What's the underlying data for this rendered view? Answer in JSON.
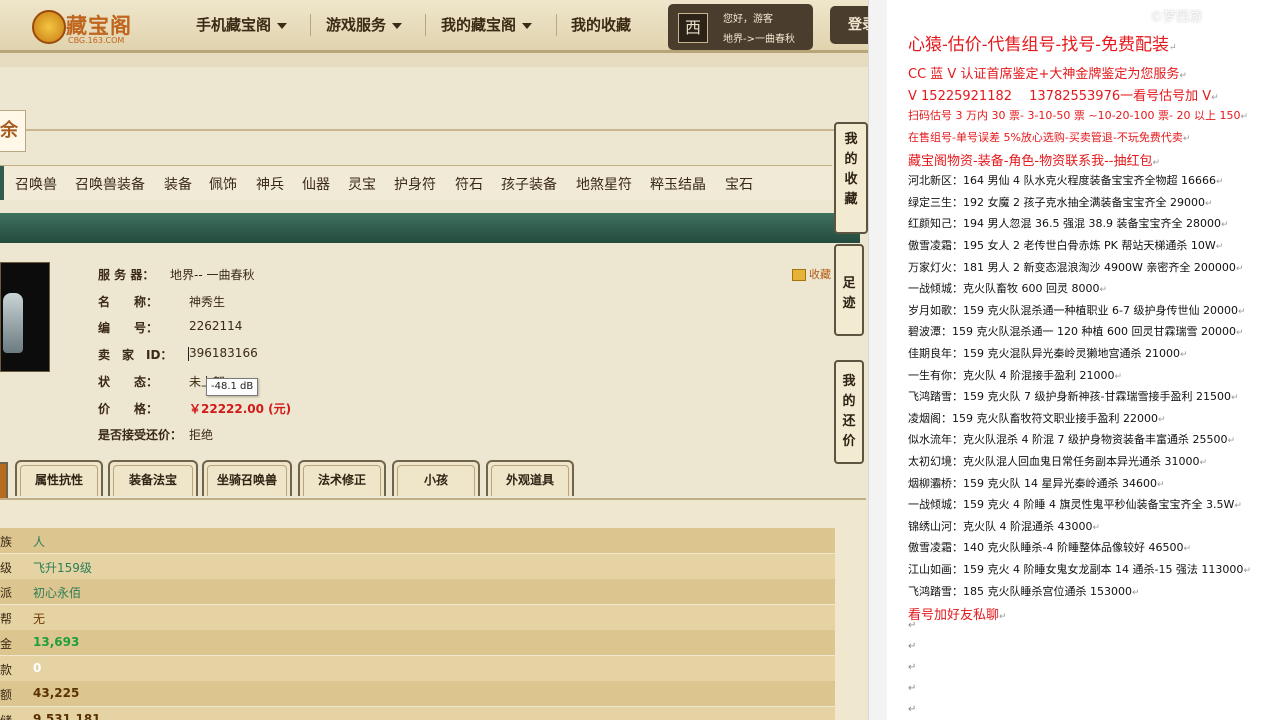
{
  "nav": {
    "logo_text": "藏宝阁",
    "logo_sub": "CBG.163.COM",
    "items": [
      "手机藏宝阁",
      "游戏服务",
      "我的藏宝阁",
      "我的收藏"
    ],
    "user_greeting": "您好，游客",
    "user_server": "地界->一曲春秋",
    "login": "登录"
  },
  "banner_char": "余",
  "categories": [
    "召唤兽",
    "召唤兽装备",
    "装备",
    "佩饰",
    "神兵",
    "仙器",
    "灵宝",
    "护身符",
    "符石",
    "孩子装备",
    "地煞星符",
    "粹玉结晶",
    "宝石"
  ],
  "item": {
    "server_label": "服 务 器：",
    "server_value": "地界-- 一曲春秋",
    "name_label": "名　　称：",
    "name_value": "神秀生",
    "id_label": "编　　号：",
    "id_value": "2262114",
    "seller_label": "卖　家　ID：",
    "seller_value": "396183166",
    "status_label": "状　　态：",
    "status_value": "未上架",
    "price_label": "价　　格：",
    "price_value": "￥22222.00 (元)",
    "bargain_label": "是否接受还价：",
    "bargain_value": "拒绝",
    "favorite": "收藏"
  },
  "tooltip": "-48.1 dB",
  "side_tabs": [
    "我的收藏",
    "足迹",
    "我的还价"
  ],
  "tabs": [
    "属性抗性",
    "装备法宝",
    "坐骑召唤兽",
    "法术修正",
    "小孩",
    "外观道具"
  ],
  "stats": [
    {
      "k": "族",
      "v": "人",
      "color": "#2e7d58"
    },
    {
      "k": "级",
      "v": "飞升159级",
      "color": "#2e7d58"
    },
    {
      "k": "派",
      "v": "初心永佰",
      "color": "#2e7d58"
    },
    {
      "k": "帮",
      "v": "无",
      "color": "#6b3b00"
    },
    {
      "k": "金",
      "v": "13,693",
      "color": "#1f9e3a"
    },
    {
      "k": "款",
      "v": "0",
      "color": "#ffffff"
    },
    {
      "k": "额",
      "v": "43,225",
      "color": "#5a3200"
    },
    {
      "k": "储",
      "v": "9,531,181",
      "color": "#5a3200"
    }
  ],
  "doc": {
    "title": "心猿-估价-代售组号-找号-免费配装",
    "lines": [
      {
        "t": "CC 蓝 V 认证首席鉴定+大神金牌鉴定为您服务",
        "s": "red-lg"
      },
      {
        "t": "V 15225921182　  13782553976一看号估号加 V",
        "s": "red-lg"
      },
      {
        "t": "扫码估号 3 万内 30 票- 3-10-50 票  ~10-20-100 票- 20 以上 150",
        "s": "red-sm"
      },
      {
        "t": "在售组号-单号误差 5%放心选购-买卖管退-不玩免费代卖",
        "s": "red-sm"
      },
      {
        "t": "藏宝阁物资-装备-角色-物资联系我--抽红包",
        "s": "red-lg"
      },
      {
        "t": "河北新区：164 男仙 4 队水克火程度装备宝宝齐全物超 16666",
        "s": "black"
      },
      {
        "t": "绿定三生：192 女魔 2 孩子克水抽全满装备宝宝齐全 29000",
        "s": "black"
      },
      {
        "t": "红颜知己：194 男人忽混 36.5 强混 38.9 装备宝宝齐全 28000",
        "s": "black"
      },
      {
        "t": "傲雪凌霜：195 女人 2 老传世白骨赤炼 PK 帮站天梯通杀 10W",
        "s": "black"
      },
      {
        "t": "万家灯火：181 男人 2 新变态混浪淘沙 4900W 亲密齐全 200000",
        "s": "black"
      },
      {
        "t": "一战倾城：克火队畜牧 600 回灵 8000",
        "s": "black"
      },
      {
        "t": "岁月如歌：159 克火队混杀通一种植职业 6-7 级护身传世仙 20000",
        "s": "black"
      },
      {
        "t": "碧波潭：159 克火队混杀通一 120 种植 600 回灵甘霖瑞雪 20000",
        "s": "black"
      },
      {
        "t": "佳期良年：159 克火混队异光秦岭灵獭地宫通杀 21000",
        "s": "black"
      },
      {
        "t": "一生有你：克火队 4 阶混接手盈利 21000",
        "s": "black"
      },
      {
        "t": "飞鸿踏雪：159 克火队 7 级护身新神孩-甘霖瑞雪接手盈利 21500",
        "s": "black"
      },
      {
        "t": "凌烟阁：159 克火队畜牧符文职业接手盈利 22000",
        "s": "black"
      },
      {
        "t": "似水流年：克火队混杀 4 阶混 7 级护身物资装备丰富通杀 25500",
        "s": "black"
      },
      {
        "t": "太初幻境：克火队混人回血鬼日常任务副本异光通杀 31000",
        "s": "black"
      },
      {
        "t": "烟柳灞桥：159 克火队 14 星异光秦岭通杀 34600",
        "s": "black"
      },
      {
        "t": "一战倾城：159 克火 4 阶睡 4 旗灵性鬼平秒仙装备宝宝齐全 3.5W",
        "s": "black"
      },
      {
        "t": "锦绣山河：克火队 4 阶混通杀 43000",
        "s": "black"
      },
      {
        "t": "傲雪凌霜：140 克火队睡杀-4 阶睡整体品像较好 46500",
        "s": "black"
      },
      {
        "t": "江山如画：159 克火 4 阶睡女鬼女龙副本 14 通杀-15 强法 113000",
        "s": "black"
      },
      {
        "t": "飞鸿踏雪：185 克火队睡杀宫位通杀 153000",
        "s": "black"
      },
      {
        "t": "看号加好友私聊",
        "s": "red-lg"
      }
    ],
    "para_mark": "↵",
    "watermark": "©梦西游"
  }
}
